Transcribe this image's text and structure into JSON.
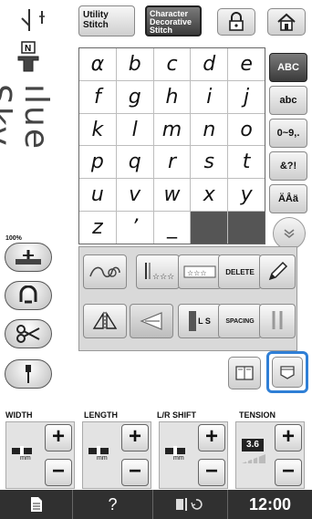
{
  "top_tabs": {
    "utility_line1": "Utility",
    "utility_line2": "Stitch",
    "char_line1": "Character",
    "char_line2": "Decorative",
    "char_line3": "Stitch"
  },
  "sidebar": {
    "preview_text": "ılue Sky",
    "zoom": "100%"
  },
  "grid": {
    "rows": [
      [
        "α",
        "b",
        "c",
        "d",
        "e"
      ],
      [
        "f",
        "g",
        "h",
        "i",
        "j"
      ],
      [
        "k",
        "l",
        "m",
        "n",
        "o"
      ],
      [
        "p",
        "q",
        "r",
        "s",
        "t"
      ],
      [
        "u",
        "v",
        "w",
        "x",
        "y"
      ],
      [
        "z",
        "’",
        "_",
        "",
        ""
      ]
    ]
  },
  "char_sets": [
    "ABC",
    "abc",
    "0~9,.",
    "&?!",
    "ÄÅä"
  ],
  "panel": {
    "delete": "DELETE",
    "ls": "L S",
    "spacing": "SPACING"
  },
  "settings": {
    "width_label": "WIDTH",
    "length_label": "LENGTH",
    "shift_label": "L/R SHIFT",
    "tension_label": "TENSION",
    "mm": "mm",
    "tension_value": "3.6",
    "plus": "+",
    "minus": "−"
  },
  "status": {
    "question": "?",
    "time": "12:00"
  }
}
